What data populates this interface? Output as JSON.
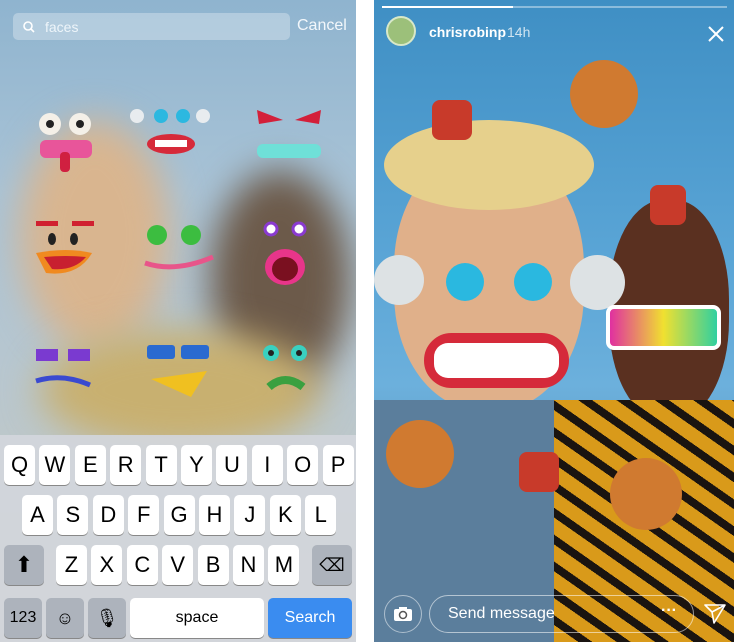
{
  "search": {
    "value": "faces",
    "cancel_label": "Cancel"
  },
  "stickers": [
    "googly-eyes-tongue-face",
    "blue-eyes-teeth-face",
    "angry-eyes-grin-face",
    "red-brows-open-mouth-face",
    "green-eyes-long-smile-face",
    "purple-eyes-shout-face",
    "purple-squint-face",
    "sunglasses-yellow-mouth-face",
    "green-eyes-frown-face"
  ],
  "keyboard": {
    "row1": [
      "Q",
      "W",
      "E",
      "R",
      "T",
      "Y",
      "U",
      "I",
      "O",
      "P"
    ],
    "row2": [
      "A",
      "S",
      "D",
      "F",
      "G",
      "H",
      "J",
      "K",
      "L"
    ],
    "row3": [
      "Z",
      "X",
      "C",
      "V",
      "B",
      "N",
      "M"
    ],
    "numbers_label": "123",
    "space_label": "space",
    "search_label": "Search"
  },
  "story": {
    "username": "chrisrobinp",
    "time": "14h",
    "progress": 0.38,
    "message_placeholder": "Send message"
  }
}
